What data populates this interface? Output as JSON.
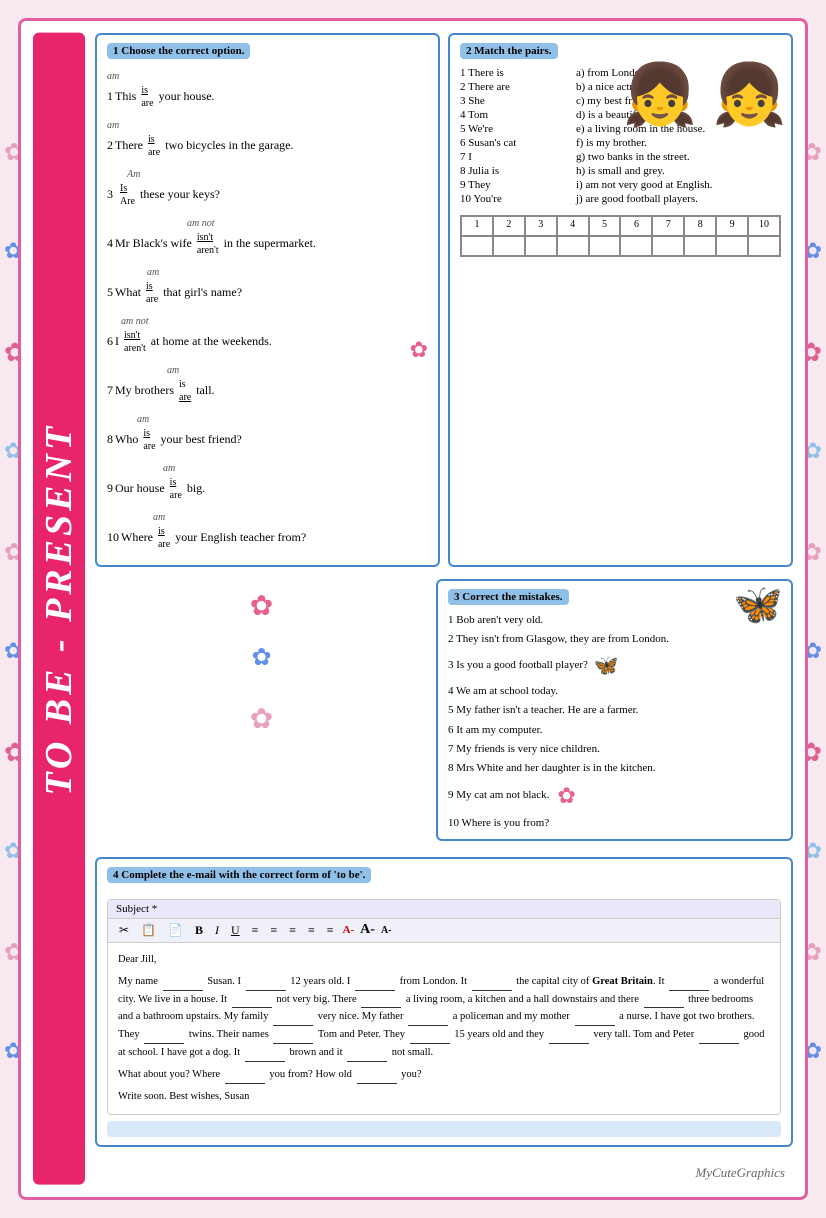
{
  "page": {
    "title": "TO BE - PRESENT",
    "background_color": "#f8e0f0",
    "border_color": "#e060a0"
  },
  "exercise1": {
    "title": "1 Choose the correct option.",
    "items": [
      {
        "num": "1",
        "prefix": "This",
        "choices": [
          "am",
          "is",
          "are"
        ],
        "selected": "is",
        "suffix": "your house."
      },
      {
        "num": "2",
        "prefix": "There",
        "choices": [
          "am",
          "is",
          "are"
        ],
        "selected": "is",
        "suffix": "two bicycles in the garage."
      },
      {
        "num": "3",
        "prefix": "",
        "choices": [
          "Am",
          "Is",
          "Are"
        ],
        "selected": "Is",
        "suffix": "these your keys?"
      },
      {
        "num": "4",
        "prefix": "Mr Black's wife",
        "choices": [
          "am not",
          "isn't",
          "aren't"
        ],
        "selected": "isn't",
        "suffix": "in the supermarket."
      },
      {
        "num": "5",
        "prefix": "What",
        "choices": [
          "am",
          "is",
          "are"
        ],
        "selected": "is",
        "suffix": "that girl's name?"
      },
      {
        "num": "6",
        "prefix": "I",
        "choices": [
          "am not",
          "isn't",
          "aren't"
        ],
        "selected": "isn't",
        "suffix": "at home at the weekends."
      },
      {
        "num": "7",
        "prefix": "My brothers",
        "choices": [
          "am",
          "is",
          "are"
        ],
        "selected": "are",
        "suffix": "tall."
      },
      {
        "num": "8",
        "prefix": "Who",
        "choices": [
          "am",
          "is",
          "are"
        ],
        "selected": "is",
        "suffix": "your best friend?"
      },
      {
        "num": "9",
        "prefix": "Our house",
        "choices": [
          "am",
          "is",
          "are"
        ],
        "selected": "is",
        "suffix": "big."
      },
      {
        "num": "10",
        "prefix": "Where",
        "choices": [
          "am",
          "is",
          "are"
        ],
        "selected": "is",
        "suffix": "your English teacher from?"
      }
    ]
  },
  "exercise2": {
    "title": "2 Match the pairs.",
    "pairs_left": [
      "1 There is",
      "2 There are",
      "3 She",
      "4 Tom",
      "5 We're",
      "6 Susan's cat",
      "7 I",
      "8 Julia is",
      "9 They",
      "10 You're"
    ],
    "pairs_right": [
      "a) from London.",
      "b) a nice actress.",
      "c) my best friend.",
      "d) is a beautiful girl.",
      "e) a living room in the house.",
      "f) is my brother.",
      "g) two banks in the street.",
      "h) is small and grey.",
      "i) am not very good at English.",
      "j) are good football players."
    ],
    "grid_headers": [
      "1",
      "2",
      "3",
      "4",
      "5",
      "6",
      "7",
      "8",
      "9",
      "10"
    ]
  },
  "exercise3": {
    "title": "3 Correct the mistakes.",
    "items": [
      "1 Bob aren't very old.",
      "2 They isn't from Glasgow, they are from London.",
      "3 Is you a good football player?",
      "4 We am at school today.",
      "5 My father isn't a teacher. He are a farmer.",
      "6 It am my computer.",
      "7 My friends is very nice children.",
      "8 Mrs White and her daughter is in the kitchen.",
      "9 My cat am not black.",
      "10 Where is you from?"
    ]
  },
  "exercise4": {
    "title": "4 Complete the e-mail with the correct form of 'to be'.",
    "subject_label": "Subject *",
    "toolbar": {
      "icons": [
        "✂",
        "📋",
        "📄",
        "B",
        "I",
        "U",
        "≡",
        "≡",
        "≡",
        "≡",
        "≡",
        "A-",
        "A-",
        "A-"
      ]
    },
    "body": {
      "opening": "Dear Jill,",
      "paragraphs": [
        "My name _____ Susan. I _____ 12 years old. I _____ from London. It _____ the capital city of Great Britain. It _____ a wonderful city. We live in a house. It _____ not very big. There _____ a living room, a kitchen and a hall downstairs and there _____ three bedrooms and a bathroom upstairs. My family _____ very nice. My father _____ a policeman and my mother _____ a nurse. I have got two brothers. They _____ twins. Their names _____ Tom and Peter. They _____ 15 years old and they _____ very tall. Tom and Peter _____ good at school. I have got a dog. It _____ brown and it _____ not small.",
        "What about you? Where _____ you from? How old _____ you?",
        "Write soon. Best wishes, Susan"
      ]
    }
  },
  "credit": "MyCuteGraphics"
}
